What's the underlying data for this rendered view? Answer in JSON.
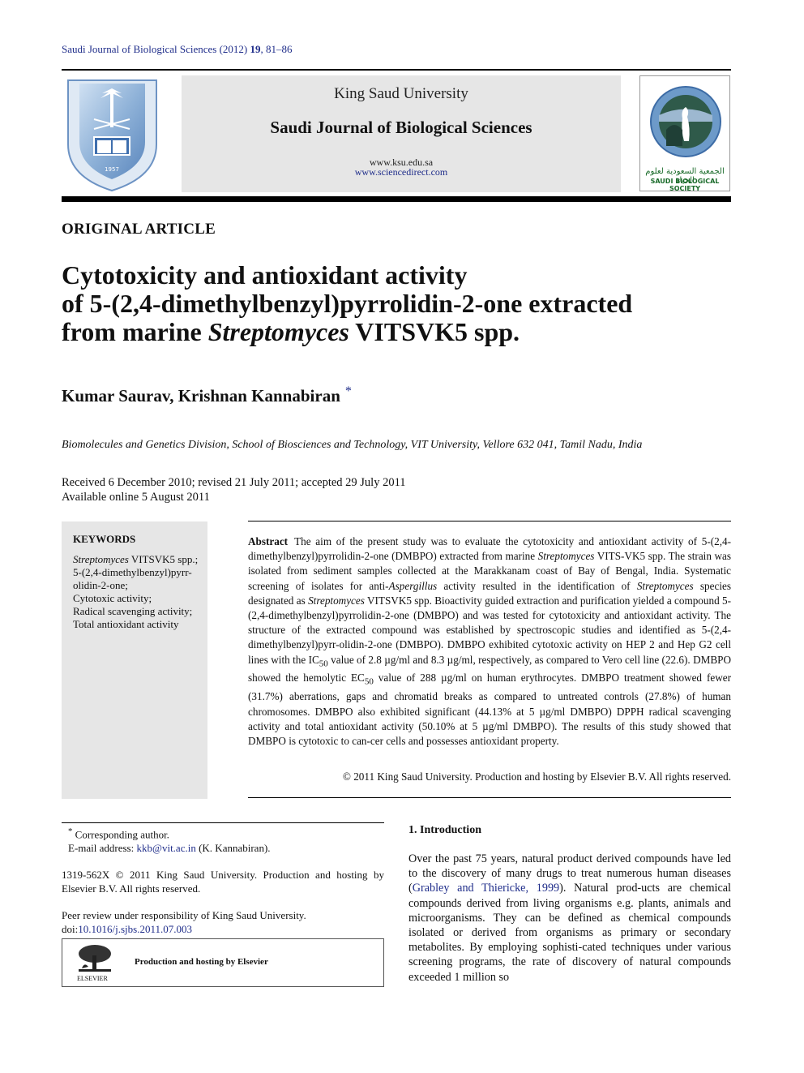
{
  "header": {
    "journal_ref_prefix": "Saudi Journal of Biological Sciences (2012) ",
    "journal_ref_volume": "19",
    "journal_ref_pages": ", 81–86",
    "banner": {
      "university": "King Saud University",
      "journal_name": "Saudi Journal of Biological Sciences",
      "url1": "www.ksu.edu.sa",
      "url2": "www.sciencedirect.com"
    },
    "left_logo": "King Saud University 1957 crest",
    "right_logo": {
      "arabic": "الجمعية السعودية لعلوم الحياة",
      "english": "SAUDI BIOLOGICAL SOCIETY"
    }
  },
  "article": {
    "type": "ORIGINAL ARTICLE",
    "title_line1": "Cytotoxicity and antioxidant activity",
    "title_line2": "of 5-(2,4-dimethylbenzyl)pyrrolidin-2-one extracted",
    "title_line3_pre": "from marine ",
    "title_line3_italic": "Streptomyces",
    "title_line3_post": " VITSVK5 spp.",
    "authors": "Kumar Saurav, Krishnan Kannabiran",
    "author_mark": "*",
    "affiliation": "Biomolecules and Genetics Division, School of Biosciences and Technology, VIT University, Vellore 632 041, Tamil Nadu, India",
    "received": "Received 6 December 2010; revised 21 July 2011; accepted 29 July 2011",
    "available": "Available online 5 August 2011"
  },
  "keywords": {
    "title": "KEYWORDS",
    "items": [
      {
        "italic": "Streptomyces",
        "text": " VITSVK5 spp.;"
      },
      {
        "italic": "",
        "text": "5-(2,4-dimethylbenzyl)pyrr-olidin-2-one;"
      },
      {
        "italic": "",
        "text": "Cytotoxic activity;"
      },
      {
        "italic": "",
        "text": "Radical scavenging activity;"
      },
      {
        "italic": "",
        "text": "Total antioxidant activity"
      }
    ]
  },
  "abstract": {
    "label": "Abstract",
    "p1": "The aim of the present study was to evaluate the cytotoxicity and antioxidant activity of 5-(2,4-dimethylbenzyl)pyrrolidin-2-one (DMBPO) extracted from marine ",
    "i1": "Streptomyces",
    "p2": " VITS-VK5 spp. The strain was isolated from sediment samples collected at the Marakkanam coast of Bay of Bengal, India. Systematic screening of isolates for anti-",
    "i2": "Aspergillus",
    "p3": " activity resulted in the identification of ",
    "i3": "Streptomyces",
    "p4": " species designated as ",
    "i4": "Streptomyces",
    "p5": " VITSVK5 spp. Bioactivity guided extraction and purification yielded a compound 5-(2,4-dimethylbenzyl)pyrrolidin-2-one (DMBPO) and was tested for cytotoxicity and antioxidant activity. The structure of the extracted compound was established by spectroscopic studies and identified as 5-(2,4-dimethylbenzyl)pyrr-olidin-2-one (DMBPO). DMBPO exhibited cytotoxic activity on HEP 2 and Hep G2 cell lines with the IC",
    "sub1": "50",
    "p6": " value of 2.8 µg/ml and 8.3 µg/ml, respectively, as compared to Vero cell line (22.6). DMBPO showed the hemolytic EC",
    "sub2": "50",
    "p7": " value of 288 µg/ml on human erythrocytes. DMBPO treatment showed fewer (31.7%) aberrations, gaps and chromatid breaks as compared to untreated controls (27.8%) of human chromosomes. DMBPO also exhibited significant (44.13% at 5 µg/ml DMBPO) DPPH radical scavenging activity and total antioxidant activity (50.10% at 5 µg/ml DMBPO). The results of this study showed that DMBPO is cytotoxic to can-cer cells and possesses antioxidant property.",
    "copyright": "© 2011 King Saud University. Production and hosting by Elsevier B.V. All rights reserved."
  },
  "footnotes": {
    "star": "*",
    "corresponding": " Corresponding author.",
    "email_label": "E-mail address: ",
    "email": "kkb@vit.ac.in",
    "email_suffix": " (K. Kannabiran).",
    "issn": "1319-562X © 2011 King Saud University. Production and hosting by Elsevier B.V. All rights reserved.",
    "peer_review": "Peer review under responsibility of King Saud University.",
    "doi_label": "doi:",
    "doi": "10.1016/j.sjbs.2011.07.003",
    "elsevier_name": "ELSEVIER",
    "production": "Production and hosting by Elsevier"
  },
  "introduction": {
    "heading": "1. Introduction",
    "p1": "Over the past 75 years, natural product derived compounds have led to the discovery of many drugs to treat numerous human diseases (",
    "citation": "Grabley and Thiericke, 1999",
    "p2": "). Natural prod-ucts are chemical compounds derived from living organisms e.g. plants, animals and microorganisms. They can be defined as chemical compounds isolated or derived from organisms as primary or secondary metabolites. By employing sophisti-cated techniques under various screening programs, the rate of discovery of natural compounds exceeded 1 million so"
  }
}
